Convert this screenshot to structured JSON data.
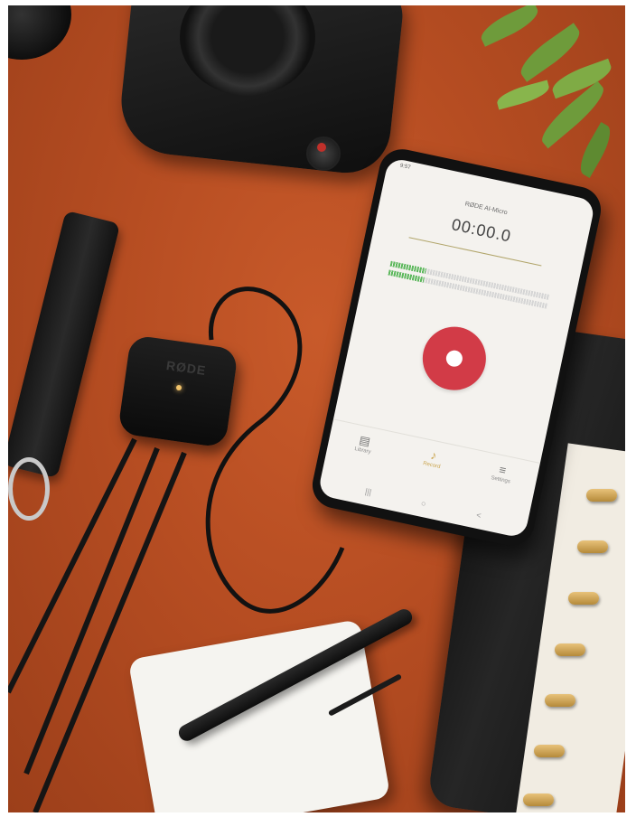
{
  "scene": {
    "background_color": "#b4502a",
    "objects": [
      "camera-icon",
      "plant-icon",
      "strap-icon",
      "audio-interface-icon",
      "smartphone-icon",
      "planner-icon",
      "notepad-icon",
      "pen-icon"
    ]
  },
  "device": {
    "brand_logo": "RØDE"
  },
  "phone": {
    "status_time": "9:57",
    "app_title": "RØDE AI-Micro",
    "timer": "00:00.0",
    "meter_level": 0.22,
    "record_button_color": "#d23b47",
    "nav": [
      {
        "label": "Library",
        "icon": "library-icon"
      },
      {
        "label": "Record",
        "icon": "microphone-icon"
      },
      {
        "label": "Settings",
        "icon": "sliders-icon"
      }
    ],
    "system_nav": [
      "|||",
      "○",
      "<"
    ]
  }
}
